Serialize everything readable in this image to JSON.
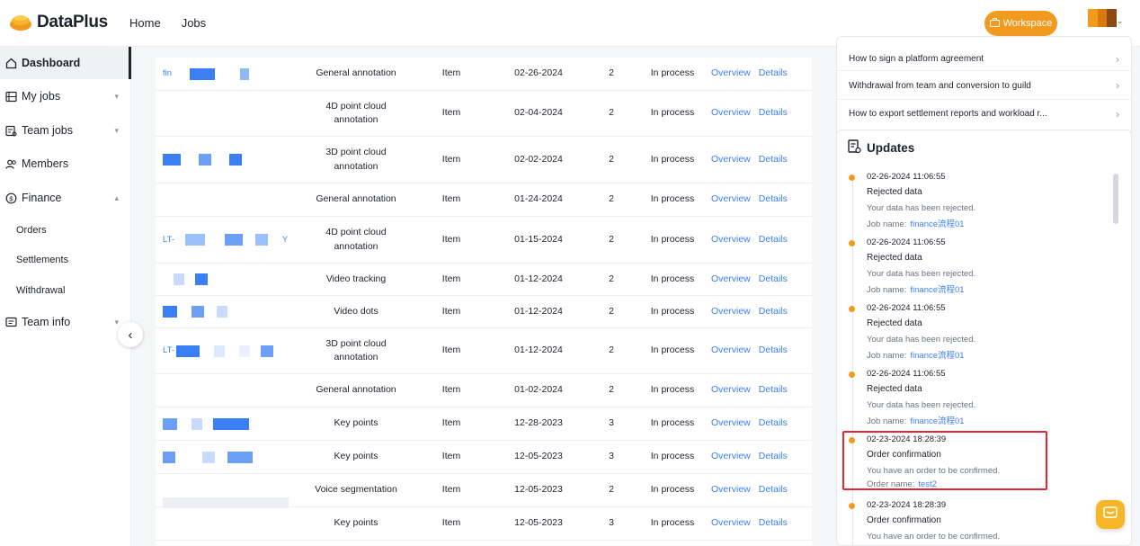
{
  "brand": {
    "name": "DataPlus"
  },
  "topnav": [
    {
      "label": "Home"
    },
    {
      "label": "Jobs"
    }
  ],
  "workspace": {
    "label": "Workspace"
  },
  "sidebar": {
    "items": [
      {
        "label": "Dashboard",
        "icon": "home-icon"
      },
      {
        "label": "My jobs",
        "icon": "jobs-icon"
      },
      {
        "label": "Team jobs",
        "icon": "team-jobs-icon"
      },
      {
        "label": "Members",
        "icon": "members-icon"
      },
      {
        "label": "Finance",
        "icon": "finance-icon"
      },
      {
        "label": "Team info",
        "icon": "team-info-icon"
      }
    ],
    "finance_sub": [
      {
        "label": "Orders"
      },
      {
        "label": "Settlements"
      },
      {
        "label": "Withdrawal"
      }
    ]
  },
  "table": {
    "rows": [
      {
        "name": "fin",
        "type": "General annotation",
        "unit": "Item",
        "date": "02-26-2024",
        "count": "2",
        "status": "In process"
      },
      {
        "name": "",
        "type": "4D point cloud\nannotation",
        "unit": "Item",
        "date": "02-04-2024",
        "count": "2",
        "status": "In process"
      },
      {
        "name": "",
        "type": "3D point cloud\nannotation",
        "unit": "Item",
        "date": "02-02-2024",
        "count": "2",
        "status": "In process"
      },
      {
        "name": "",
        "type": "General annotation",
        "unit": "Item",
        "date": "01-24-2024",
        "count": "2",
        "status": "In process"
      },
      {
        "name": "LT-",
        "type": "4D point cloud\nannotation",
        "unit": "Item",
        "date": "01-15-2024",
        "count": "2",
        "status": "In process"
      },
      {
        "name": "",
        "type": "Video tracking",
        "unit": "Item",
        "date": "01-12-2024",
        "count": "2",
        "status": "In process"
      },
      {
        "name": "",
        "type": "Video dots",
        "unit": "Item",
        "date": "01-12-2024",
        "count": "2",
        "status": "In process"
      },
      {
        "name": "LT-",
        "type": "3D point cloud\nannotation",
        "unit": "Item",
        "date": "01-12-2024",
        "count": "2",
        "status": "In process"
      },
      {
        "name": "",
        "type": "General annotation",
        "unit": "Item",
        "date": "01-02-2024",
        "count": "2",
        "status": "In process"
      },
      {
        "name": "",
        "type": "Key points",
        "unit": "Item",
        "date": "12-28-2023",
        "count": "3",
        "status": "In process"
      },
      {
        "name": "",
        "type": "Key points",
        "unit": "Item",
        "date": "12-05-2023",
        "count": "3",
        "status": "In process"
      },
      {
        "name": "",
        "type": "Voice segmentation",
        "unit": "Item",
        "date": "12-05-2023",
        "count": "2",
        "status": "In process"
      },
      {
        "name": "",
        "type": "Key points",
        "unit": "Item",
        "date": "12-05-2023",
        "count": "3",
        "status": "In process"
      }
    ],
    "ops": {
      "overview": "Overview",
      "details": "Details"
    }
  },
  "help": [
    {
      "label": "How to sign a platform agreement"
    },
    {
      "label": "Withdrawal from team and conversion to guild"
    },
    {
      "label": "How to export settlement reports and workload r..."
    }
  ],
  "updates": {
    "title": "Updates",
    "items": [
      {
        "time": "02-26-2024 11:06:55",
        "title": "Rejected data",
        "desc": "Your data has been rejected.",
        "ref_label": "Job name:",
        "ref_value": "finance流程01"
      },
      {
        "time": "02-26-2024 11:06:55",
        "title": "Rejected data",
        "desc": "Your data has been rejected.",
        "ref_label": "Job name:",
        "ref_value": "finance流程01"
      },
      {
        "time": "02-26-2024 11:06:55",
        "title": "Rejected data",
        "desc": "Your data has been rejected.",
        "ref_label": "Job name:",
        "ref_value": "finance流程01"
      },
      {
        "time": "02-26-2024 11:06:55",
        "title": "Rejected data",
        "desc": "Your data has been rejected.",
        "ref_label": "Job name:",
        "ref_value": "finance流程01"
      },
      {
        "time": "02-23-2024 18:28:39",
        "title": "Order confirmation",
        "desc": "You have an order to be confirmed.",
        "ref_label": "Order name:",
        "ref_value": "test2"
      },
      {
        "time": "02-23-2024 18:28:39",
        "title": "Order confirmation",
        "desc": "You have an order to be confirmed.",
        "ref_label": "",
        "ref_value": ""
      }
    ]
  },
  "colors": {
    "accent": "#f29a1f",
    "link": "#3b7ff5",
    "highlight": "#e0283a"
  }
}
